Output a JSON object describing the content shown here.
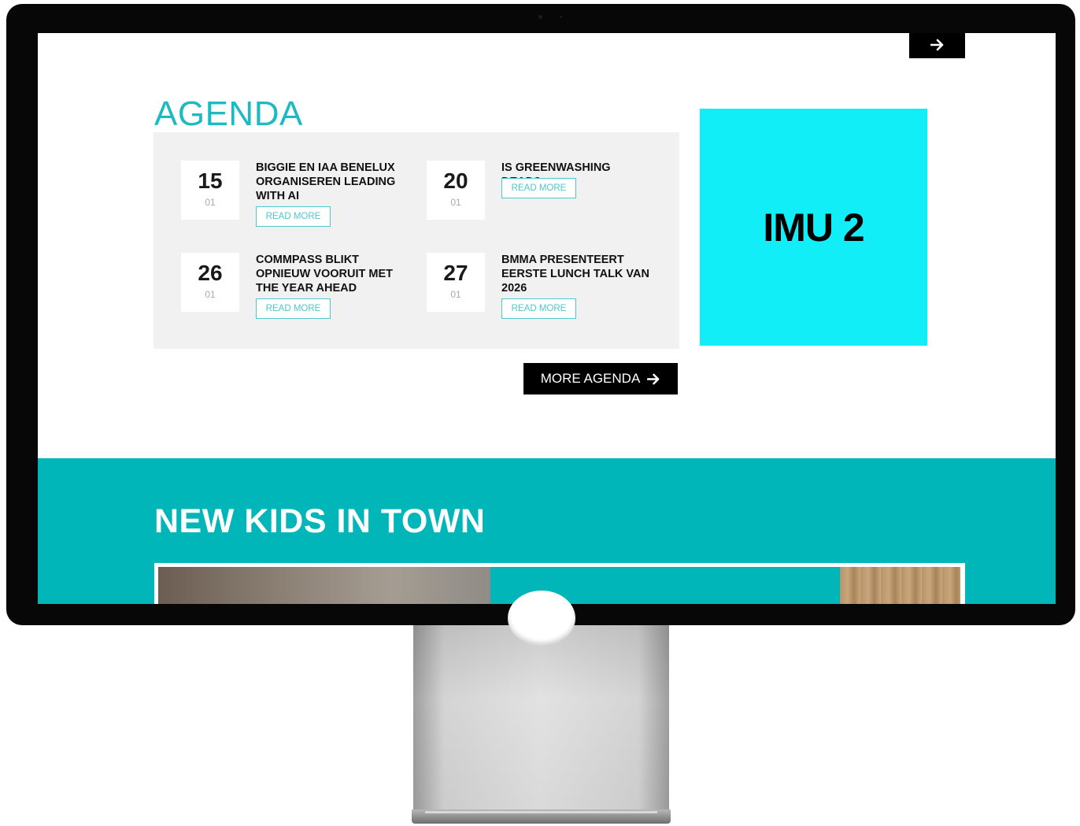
{
  "header": {
    "next_button_icon": "arrow-right-icon"
  },
  "agenda": {
    "title": "AGENDA",
    "events": [
      {
        "day": "15",
        "month": "01",
        "title": "BIGGIE EN IAA BENELUX ORGANISEREN LEADING WITH AI",
        "button": "READ MORE"
      },
      {
        "day": "20",
        "month": "01",
        "title": "IS GREENWASHING DEAD?",
        "button": "READ MORE"
      },
      {
        "day": "26",
        "month": "01",
        "title": "COMMPASS BLIKT OPNIEUW VOORUIT MET THE YEAR AHEAD",
        "button": "READ MORE"
      },
      {
        "day": "27",
        "month": "01",
        "title": "BMMA PRESENTEERT EERSTE LUNCH TALK VAN 2026",
        "button": "READ MORE"
      }
    ],
    "more_button": "MORE AGENDA"
  },
  "ad": {
    "label": "IMU 2",
    "color": "#11eef7"
  },
  "new_kids": {
    "title": "NEW KIDS IN TOWN"
  },
  "colors": {
    "accent": "#1cbac2",
    "section_bg": "#00b6b9",
    "panel_bg": "#f1f1f1"
  }
}
